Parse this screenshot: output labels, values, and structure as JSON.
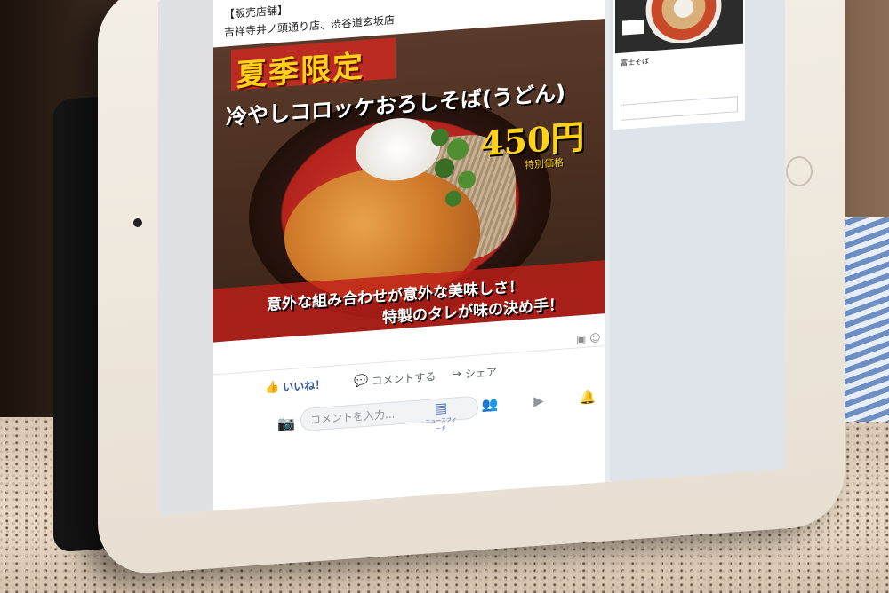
{
  "post": {
    "store_header": "【販売店舗】",
    "store_list": "吉祥寺井ノ頭通り店、渋谷道玄坂店",
    "image": {
      "title": "夏季限定",
      "subtitle": "冷やしコロッケおろしそば(うどん)",
      "price": "450円",
      "price_note": "特別価格",
      "caption_line1": "意外な組み合わせが意外な美味しさ！",
      "caption_line2": "特製のタレが味の決め手！"
    },
    "actions": {
      "like": "いいね！",
      "comment": "コメントする",
      "share": "シェア"
    },
    "comment_placeholder": "コメントを入力..."
  },
  "nav": {
    "news_feed": "ニュースフィード"
  },
  "sidebar_ad": {
    "name": "富士そば"
  },
  "colors": {
    "brand": "#4267b2",
    "like_blue": "#385898",
    "banner_red": "#c62a20",
    "title_yellow": "#ffd21a"
  },
  "icons": {
    "like": "thumbs-up-icon",
    "comment": "speech-bubble-icon",
    "share": "share-arrow-icon",
    "camera": "camera-icon",
    "news_feed": "news-feed-icon",
    "friends": "friends-icon",
    "video": "video-icon",
    "notifications": "bell-icon",
    "menu": "menu-icon"
  }
}
